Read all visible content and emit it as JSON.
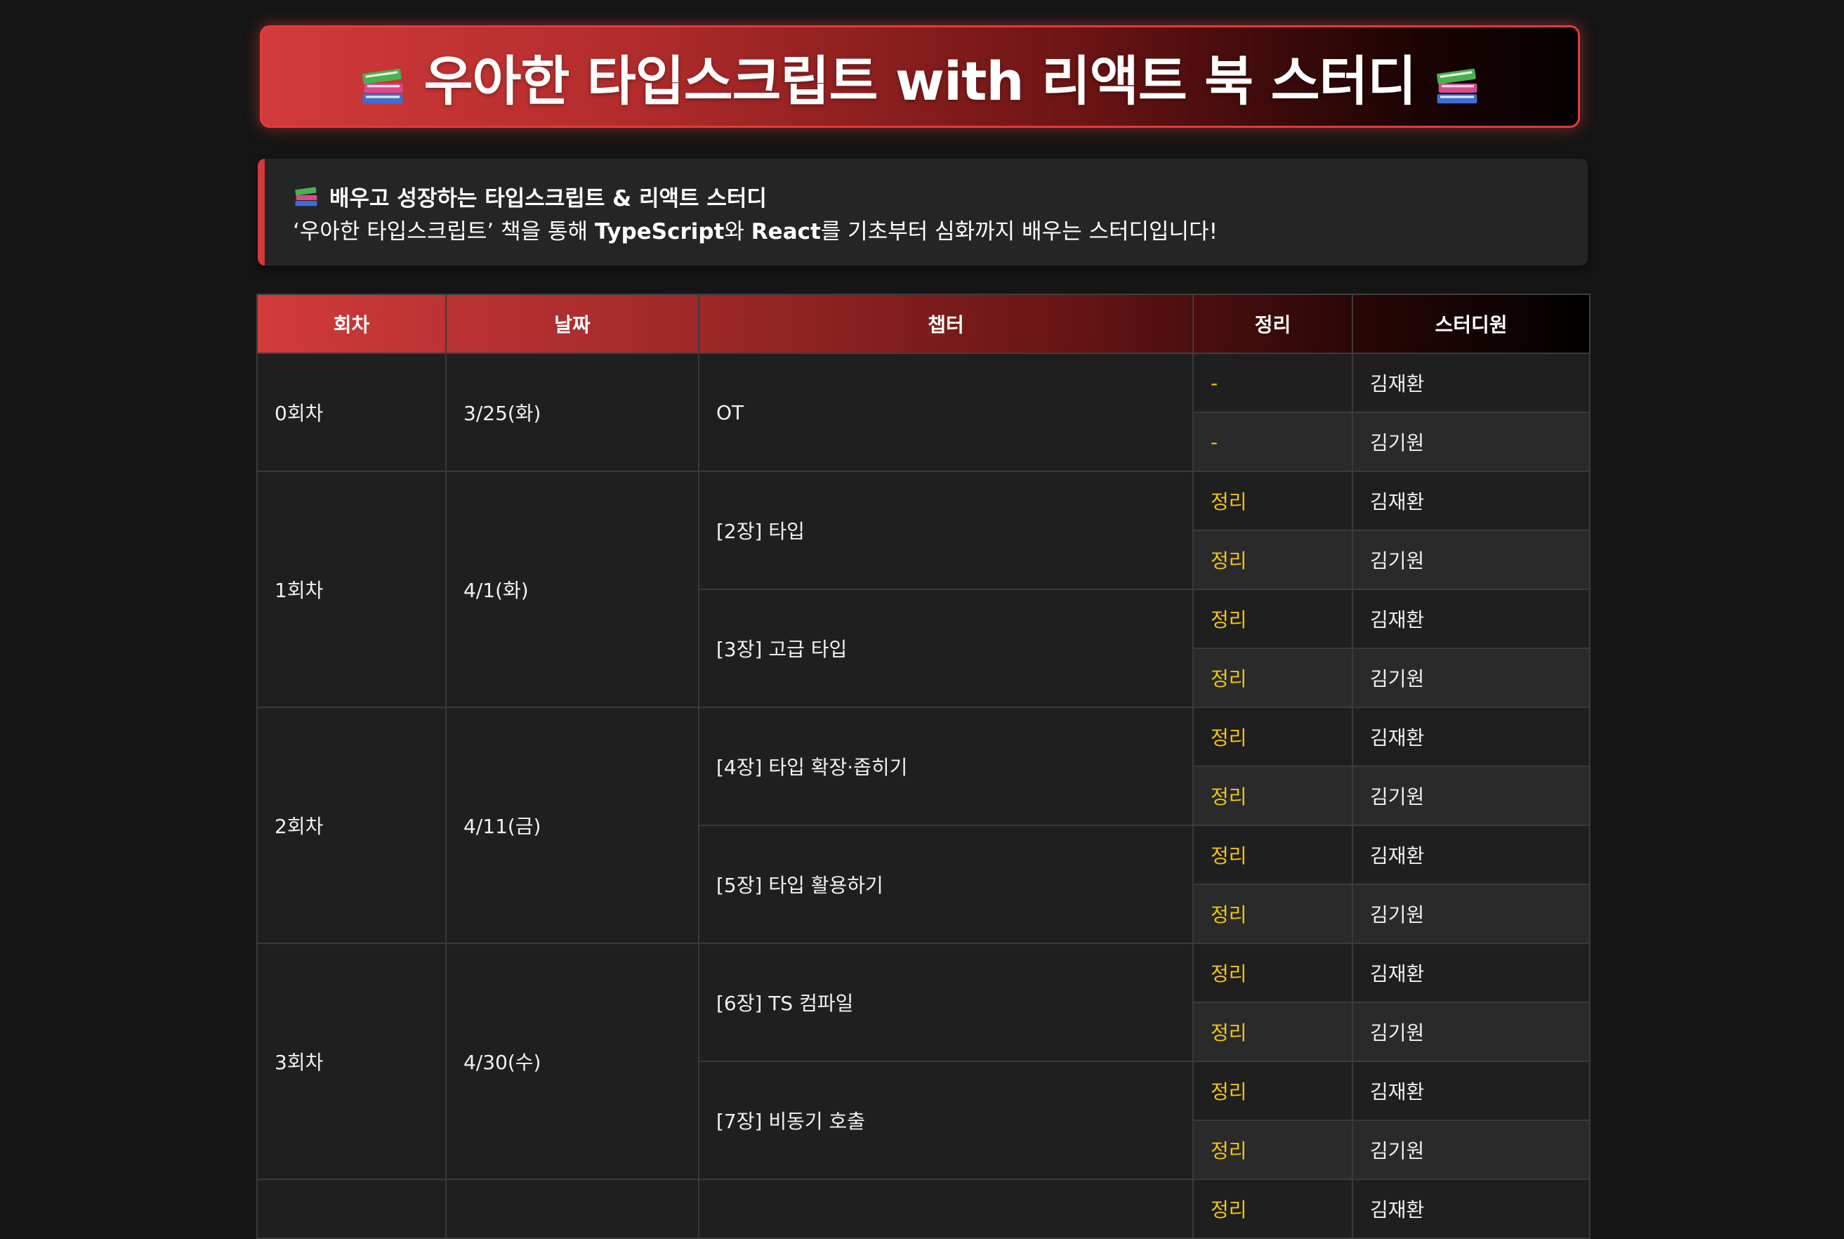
{
  "title": {
    "text": "우아한 타입스크립트 with 리액트 북 스터디",
    "icon": "books-icon"
  },
  "intro": {
    "heading": "배우고 성장하는 타입스크립트 & 리액트 스터디",
    "desc_part1": "‘우아한 타입스크립트’ 책을 통해 ",
    "desc_bold1": "TypeScript",
    "desc_part2": "와 ",
    "desc_bold2": "React",
    "desc_part3": "를 기초부터 심화까지 배우는 스터디입니다!"
  },
  "table": {
    "headers": [
      "회차",
      "날짜",
      "챕터",
      "정리",
      "스터디원"
    ],
    "rows": [
      {
        "session": "0회차",
        "date": "3/25(화)",
        "chapter": "OT",
        "note": "-",
        "member": "김재환"
      },
      {
        "note": "-",
        "member": "김기원"
      },
      {
        "session": "1회차",
        "date": "4/1(화)",
        "chapter": "[2장] 타입",
        "note": "정리",
        "member": "김재환"
      },
      {
        "note": "정리",
        "member": "김기원"
      },
      {
        "chapter": "[3장] 고급 타입",
        "note": "정리",
        "member": "김재환"
      },
      {
        "note": "정리",
        "member": "김기원"
      },
      {
        "session": "2회차",
        "date": "4/11(금)",
        "chapter": "[4장] 타입 확장·좁히기",
        "note": "정리",
        "member": "김재환"
      },
      {
        "note": "정리",
        "member": "김기원"
      },
      {
        "chapter": "[5장] 타입 활용하기",
        "note": "정리",
        "member": "김재환"
      },
      {
        "note": "정리",
        "member": "김기원"
      },
      {
        "session": "3회차",
        "date": "4/30(수)",
        "chapter": "[6장] TS 컴파일",
        "note": "정리",
        "member": "김재환"
      },
      {
        "note": "정리",
        "member": "김기원"
      },
      {
        "chapter": "[7장] 비동기 호출",
        "note": "정리",
        "member": "김재환"
      },
      {
        "note": "정리",
        "member": "김기원"
      },
      {
        "note": "정리",
        "member": "김재환"
      }
    ]
  },
  "colors": {
    "accent": "#d23a3a",
    "note": "#f0c419",
    "background": "#151515",
    "cell": "#1f1f1f",
    "cell_alt": "#2a2a2a"
  }
}
